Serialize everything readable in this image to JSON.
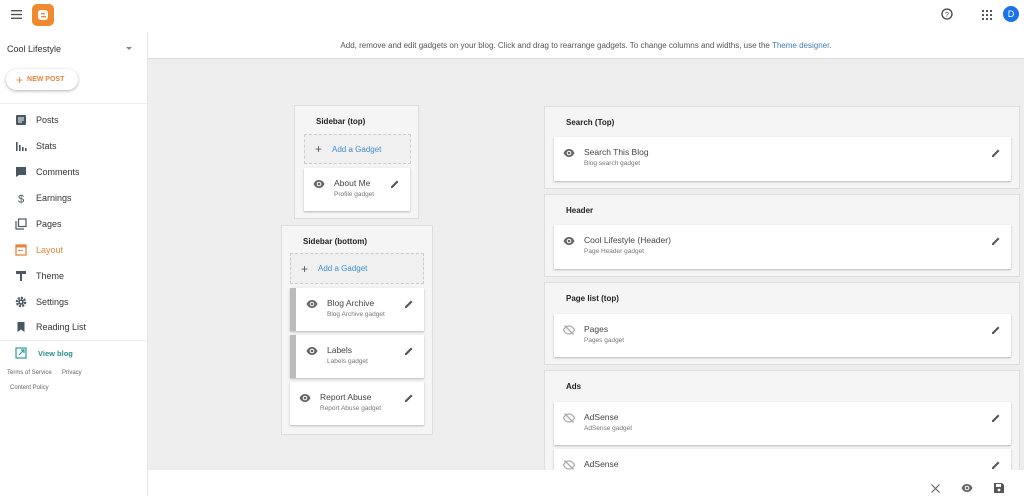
{
  "topbar": {
    "logo": "blogger-logo",
    "avatar_letter": "D",
    "icons": [
      "menu-icon",
      "help-icon",
      "apps-icon"
    ]
  },
  "sidebar": {
    "blog_name": "Cool Lifestyle",
    "new_post": "NEW POST",
    "items": [
      {
        "label": "Posts",
        "icon": "posts-icon"
      },
      {
        "label": "Stats",
        "icon": "stats-icon"
      },
      {
        "label": "Comments",
        "icon": "comments-icon"
      },
      {
        "label": "Earnings",
        "icon": "dollar-icon"
      },
      {
        "label": "Pages",
        "icon": "pages-icon"
      },
      {
        "label": "Layout",
        "icon": "layout-icon",
        "active": true
      },
      {
        "label": "Theme",
        "icon": "theme-icon"
      },
      {
        "label": "Settings",
        "icon": "gear-icon"
      },
      {
        "label": "Reading List",
        "icon": "bookmark-icon"
      }
    ],
    "view_blog": "View blog",
    "footer": {
      "terms": "Terms of Service",
      "privacy": "Privacy",
      "content": "Content Policy"
    }
  },
  "banner": {
    "text": "Add, remove and edit gadgets on your blog. Click and drag to rearrange gadgets. To change columns and widths, use the ",
    "link": "Theme designer",
    "end": "."
  },
  "sections": {
    "sidebar_top": {
      "title": "Sidebar (top)",
      "add": "Add a Gadget",
      "gadgets": [
        {
          "name": "About Me",
          "type": "Profile gadget"
        }
      ]
    },
    "sidebar_bottom": {
      "title": "Sidebar (bottom)",
      "add": "Add a Gadget",
      "gadgets": [
        {
          "name": "Blog Archive",
          "type": "Blog Archive gadget"
        },
        {
          "name": "Labels",
          "type": "Labels gadget"
        },
        {
          "name": "Report Abuse",
          "type": "Report Abuse gadget"
        }
      ]
    },
    "search": {
      "title": "Search (Top)",
      "gadgets": [
        {
          "name": "Search This Blog",
          "type": "Blog search gadget"
        }
      ]
    },
    "header": {
      "title": "Header",
      "gadgets": [
        {
          "name": "Cool Lifestyle (Header)",
          "type": "Page Header gadget"
        }
      ]
    },
    "pagelist": {
      "title": "Page list (top)",
      "gadgets": [
        {
          "name": "Pages",
          "type": "Pages gadget"
        }
      ]
    },
    "ads": {
      "title": "Ads",
      "gadgets": [
        {
          "name": "AdSense",
          "type": "AdSense gadget"
        },
        {
          "name": "AdSense",
          "type": ""
        }
      ]
    }
  },
  "colors": {
    "accent": "#e8843c",
    "link": "#3f8fcf",
    "avatar": "#1a73e8"
  }
}
